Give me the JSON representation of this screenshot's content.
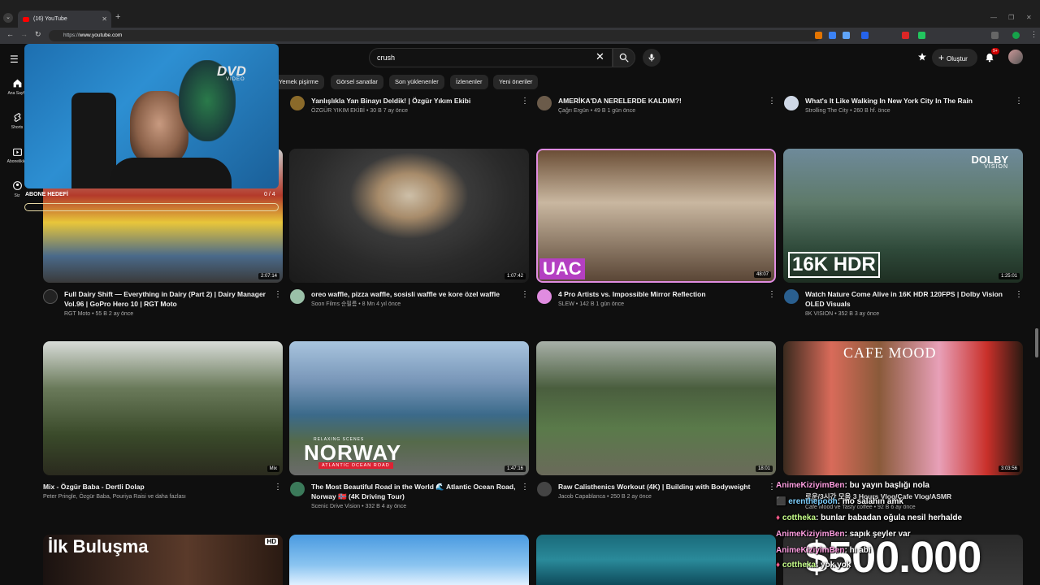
{
  "browser": {
    "tab_title": "(16) YouTube",
    "url_prefix": "https://",
    "url_domain": "www.youtube.com"
  },
  "header": {
    "search_value": "crush",
    "create_label": "Oluştur",
    "notif_count": "9+"
  },
  "sidebar": [
    {
      "label": "Ana Sayfa",
      "icon": "home-icon"
    },
    {
      "label": "Shorts",
      "icon": "shorts-icon"
    },
    {
      "label": "Abonelikler",
      "icon": "subscriptions-icon"
    },
    {
      "label": "Siz",
      "icon": "account-icon"
    }
  ],
  "chips": [
    "Yemek pişirme",
    "Görsel sanatlar",
    "Son yüklenenler",
    "İzlenenler",
    "Yeni öneriler"
  ],
  "top_row": [
    {
      "title": "Yanlışlıkla Yan Binayı Deldik! | Özgür Yıkım Ekibi",
      "channel": "ÖZGÜR YIKIM EKİBİ",
      "stats": "• 30 B  7 ay önce"
    },
    {
      "title": "AMERİKA'DA NERELERDE KALDIM?!",
      "channel": "Çağrı Ergün",
      "stats": "• 49 B  1 gün önce"
    },
    {
      "title": "What's It Like Walking In New York City In The Rain",
      "channel": "Strolling The City",
      "stats": "• 260 B  hf. önce"
    }
  ],
  "row1": [
    {
      "title": "Full Dairy Shift — Everything in Dairy (Part 2) | Dairy Manager Vol.96 | GoPro Hero 10 | RGT Moto",
      "channel": "RGT Moto",
      "stats": "• 55 B  2 ay önce",
      "duration": "2:07:14"
    },
    {
      "title": "oreo waffle, pizza waffle, sosisli waffle ve kore özel waffle",
      "channel": "Soon Films 순필름",
      "stats": "• 8 Mn  4 yıl önce",
      "duration": "1:07:42"
    },
    {
      "title": "4 Pro Artists vs. Impossible Mirror Reflection",
      "channel": "SLEW",
      "stats": "• 142 B  1 gün önce",
      "duration": "48:07",
      "thumb_text": "UAC"
    },
    {
      "title": "Watch Nature Come Alive in 16K HDR 120FPS | Dolby Vision OLED Visuals",
      "channel": "8K VISION",
      "stats": "• 352 B  3 ay önce",
      "duration": "1:25:01",
      "thumb_text": "16K HDR",
      "thumb_brand": "DOLBY",
      "thumb_brand2": "VISION"
    }
  ],
  "row2": [
    {
      "title": "Mix - Özgür Baba - Dertli Dolap",
      "channel": "Peter Pringle, Özgür Baba, Pouriya Raisi ve daha fazlası",
      "stats": "",
      "duration": "Mix"
    },
    {
      "title": "The Most Beautiful Road in the World 🌊 Atlantic Ocean Road, Norway 🇳🇴 (4K Driving Tour)",
      "channel": "Scenic Drive Vision",
      "stats": "• 332 B  4 ay önce",
      "duration": "1:47:16",
      "thumb_text": "NORWAY",
      "thumb_sub": "ATLANTIC OCEAN ROAD",
      "thumb_top": "RELAXING SCENES"
    },
    {
      "title": "Raw Calisthenics Workout (4K) | Building with Bodyweight",
      "channel": "Jacob Capablanca",
      "stats": "• 250 B  2 ay önce",
      "duration": "18:01"
    },
    {
      "title": "로운/3시간 모음 3 Hours Vlog/Cafe Vlog/ASMR",
      "channel": "Cafe Mood ve Tasty coffee",
      "stats": "• 92 B  6 ay önce",
      "duration": "3:03:56",
      "thumb_text": "CAFE MOOD"
    }
  ],
  "row3_thumb_text": "İlk Buluşma",
  "webcam": {
    "logo": "DVD",
    "logo_sub": "VIDEO",
    "goal_label": "ABONE HEDEFİ",
    "goal_count": "0 / 4",
    "goal_progress": 0
  },
  "chat": [
    {
      "user": "AnimeKiziyimBen",
      "text": ": bu yayın başlığı nola"
    },
    {
      "user": "erenthepooh",
      "text": ": mo salahın amk"
    },
    {
      "user": "cottheka",
      "text": ": bunlar babadan oğula nesil herhalde"
    },
    {
      "user": "AnimeKiziyimBen",
      "text": ": sapık şeyler var"
    },
    {
      "user": "AnimeKiziyimBen",
      "text": ": hı abi"
    },
    {
      "user": "cottheka",
      "text": ": yok yok"
    }
  ],
  "donation_amount": "$500.000",
  "colors": {
    "bg": "#0f0f0f",
    "chip": "#272727",
    "accent": "#ff0000",
    "goal_border": "#e7d9a5"
  }
}
